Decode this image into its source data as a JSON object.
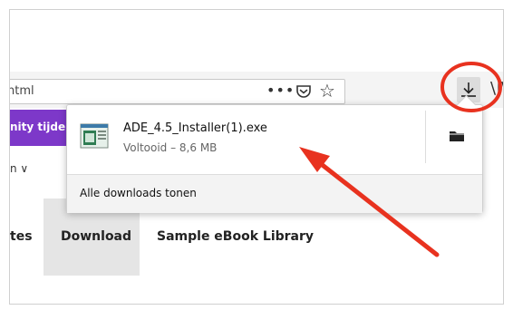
{
  "browser": {
    "url_fragment": "html",
    "more_label": "•••",
    "pocket_icon": "pocket-icon",
    "star_icon": "star-icon",
    "downloads_icon": "download-icon",
    "library_icon": "library-icon",
    "library_glyph": "\\|\\"
  },
  "page": {
    "banner_text": "nity tijdens",
    "sub_text": "n ∨",
    "nav": [
      {
        "label": "tes"
      },
      {
        "label": "Download"
      },
      {
        "label": "Sample eBook Library"
      }
    ]
  },
  "downloads_panel": {
    "item": {
      "file_name": "ADE_4.5_Installer(1).exe",
      "status": "Voltooid – 8,6 MB",
      "icon": "installer-file-icon",
      "action_icon": "folder-icon"
    },
    "footer_label": "Alle downloads tonen"
  },
  "colors": {
    "annotation_red": "#e8321f",
    "banner_purple": "#7d38c9"
  }
}
